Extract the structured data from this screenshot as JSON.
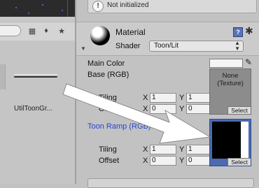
{
  "project": {
    "asset_label": "UtilToonGr..."
  },
  "inspector": {
    "status_text": "Not initialized",
    "material_title": "Material",
    "shader_label": "Shader",
    "shader_value": "Toon/Lit",
    "main_color_label": "Main Color",
    "base_label": "Base (RGB)",
    "tiling_label": "Tiling",
    "offset_label": "Offset",
    "x_label": "X",
    "y_label": "Y",
    "base_tiling_x": "1",
    "base_tiling_y": "1",
    "base_offset_x": "0",
    "base_offset_y": "0",
    "texture_none_line1": "None",
    "texture_none_line2": "(Texture)",
    "select_label": "Select",
    "toon_ramp_label": "Toon Ramp (RGB)",
    "ramp_tiling_x": "1",
    "ramp_tiling_y": "1",
    "ramp_offset_x": "0",
    "ramp_offset_y": "0"
  },
  "colors": {
    "toon_ramp_label": "#2145d6",
    "selection_border": "#4c6ab0",
    "annotation_arrow": "#ffffff"
  },
  "icons": [
    "info-icon",
    "material-sphere-icon",
    "help-icon",
    "gear-icon",
    "eyedropper-icon",
    "lock-icon",
    "tag-icon",
    "star-icon"
  ]
}
